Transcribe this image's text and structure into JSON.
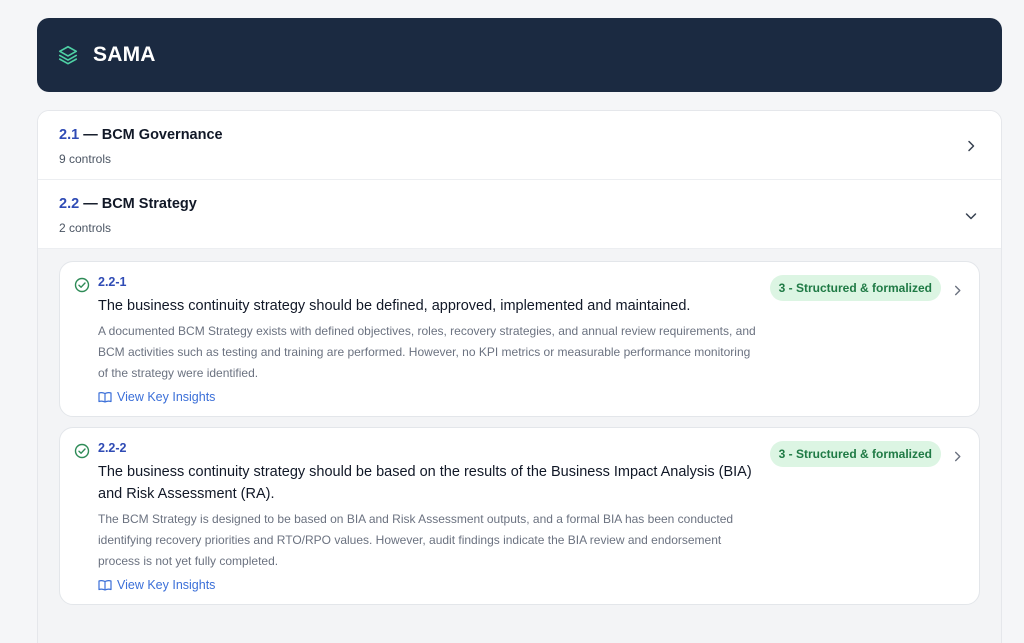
{
  "header": {
    "title": "SAMA",
    "icon": "layers-icon",
    "background": "#1b2a41"
  },
  "sections": [
    {
      "number": "2.1",
      "separator": " — ",
      "name": "BCM Governance",
      "count": "9 controls",
      "state": "collapsed",
      "icon": "chevron-right-icon"
    },
    {
      "number": "2.2",
      "separator": " — ",
      "name": "BCM Strategy",
      "count": "2 controls",
      "state": "expanded",
      "icon": "chevron-down-icon",
      "controls": [
        {
          "id": "2.2-1",
          "title": "The business continuity strategy should be defined, approved, implemented and maintained.",
          "description": "A documented BCM Strategy exists with defined objectives, roles, recovery strategies, and annual review requirements, and BCM activities such as testing and training are performed. However, no KPI metrics or measurable performance monitoring of the strategy were identified.",
          "badge": "3 - Structured & formalized",
          "insights_label": "View Key Insights"
        },
        {
          "id": "2.2-2",
          "title": "The business continuity strategy should be based on the results of the Business Impact Analysis (BIA) and Risk Assessment (RA).",
          "description": "The BCM Strategy is designed to be based on BIA and Risk Assessment outputs, and a formal BIA has been conducted identifying recovery priorities and RTO/RPO values. However, audit findings indicate the BIA review and endorsement process is not yet fully completed.",
          "badge": "3 - Structured & formalized",
          "insights_label": "View Key Insights"
        }
      ]
    }
  ],
  "colors": {
    "accent": "#2f4bb5",
    "link": "#3b6fd8",
    "badge_bg": "#dcf5e3",
    "badge_text": "#1f7a45",
    "check": "#2e8b57"
  }
}
